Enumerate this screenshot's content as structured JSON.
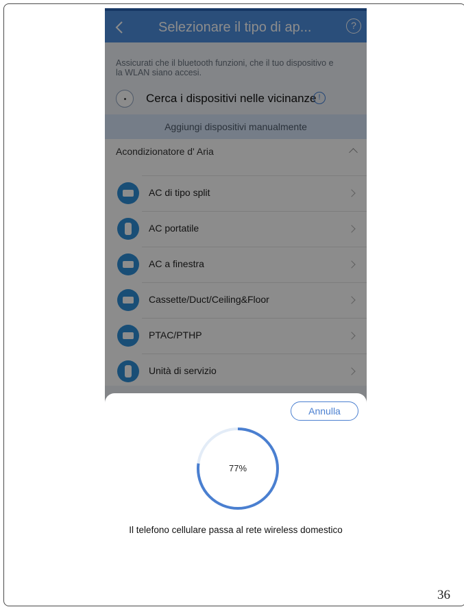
{
  "header": {
    "title": "Selezionare il tipo di ap..."
  },
  "info": {
    "text": "Assicurati che il bluetooth funzioni, che il tuo dispositivo e la WLAN siano accesi.",
    "scan_label": "Cerca i dispositivi nelle vicinanze"
  },
  "manual_add_label": "Aggiungi dispositivi manualmente",
  "section": {
    "title": "Acondizionatore d' Aria"
  },
  "items": [
    {
      "label": "AC di tipo split",
      "icon": "split-ac-icon"
    },
    {
      "label": "AC portatile",
      "icon": "portable-ac-icon"
    },
    {
      "label": "AC a finestra",
      "icon": "window-ac-icon"
    },
    {
      "label": "Cassette/Duct/Ceiling&Floor",
      "icon": "cassette-ac-icon"
    },
    {
      "label": "PTAC/PTHP",
      "icon": "ptac-icon"
    },
    {
      "label": "Unità di servizio",
      "icon": "service-unit-icon"
    }
  ],
  "sheet": {
    "cancel_label": "Annulla",
    "progress": 0.77,
    "progress_label": "77%",
    "status": "Il telefono cellulare passa al rete wireless domestico"
  },
  "page_number": "36",
  "colors": {
    "accent": "#4d8ede",
    "progress": "#4a7fd0",
    "progress_track": "#e3ecf7"
  }
}
